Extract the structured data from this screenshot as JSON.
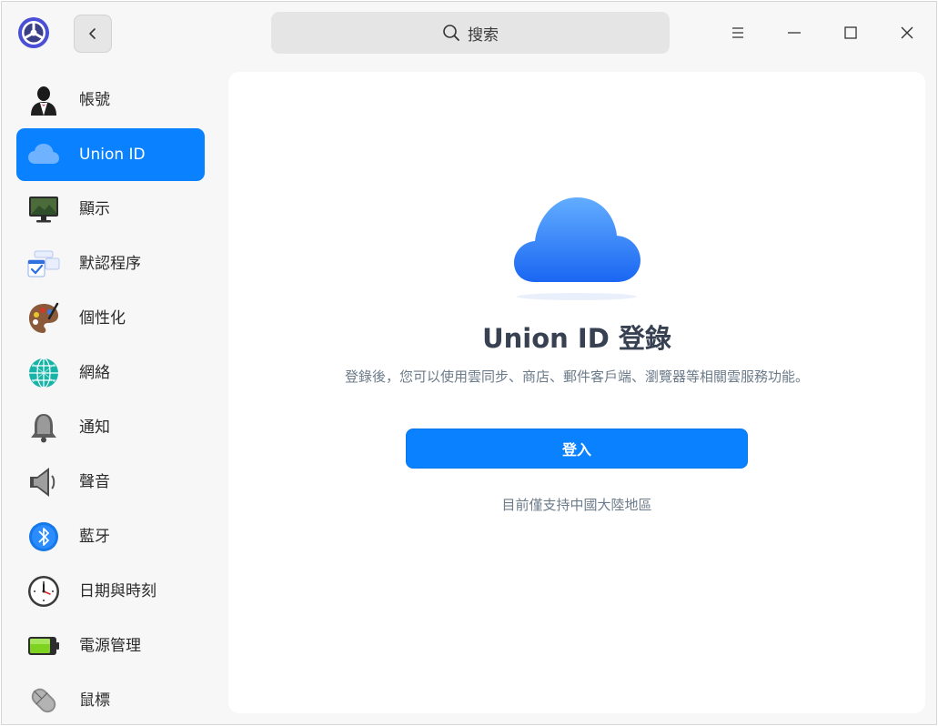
{
  "titlebar": {
    "search_placeholder": "搜索"
  },
  "sidebar": {
    "items": [
      {
        "label": "帳號",
        "icon": "account-icon"
      },
      {
        "label": "Union ID",
        "icon": "cloud-icon",
        "active": true
      },
      {
        "label": "顯示",
        "icon": "display-icon"
      },
      {
        "label": "默認程序",
        "icon": "default-apps-icon"
      },
      {
        "label": "個性化",
        "icon": "palette-icon"
      },
      {
        "label": "網絡",
        "icon": "network-globe-icon"
      },
      {
        "label": "通知",
        "icon": "bell-icon"
      },
      {
        "label": "聲音",
        "icon": "speaker-icon"
      },
      {
        "label": "藍牙",
        "icon": "bluetooth-icon"
      },
      {
        "label": "日期與時刻",
        "icon": "clock-icon"
      },
      {
        "label": "電源管理",
        "icon": "battery-icon"
      },
      {
        "label": "鼠標",
        "icon": "mouse-icon"
      }
    ]
  },
  "main": {
    "title": "Union ID 登錄",
    "description": "登錄後，您可以使用雲同步、商店、郵件客戶端、瀏覽器等相關雲服務功能。",
    "login_button": "登入",
    "region_note": "目前僅支持中國大陸地區"
  },
  "colors": {
    "accent": "#0a81ff",
    "cloud_light": "#5aa8ff",
    "cloud_dark": "#1d6cf5"
  }
}
